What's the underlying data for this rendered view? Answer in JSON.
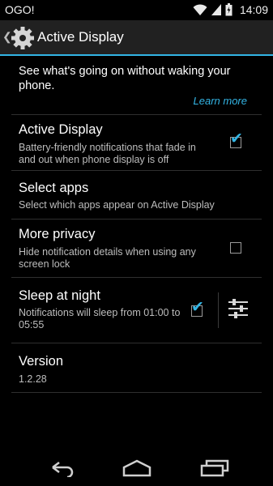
{
  "statusbar": {
    "carrier": "OGO!",
    "time": "14:09"
  },
  "actionbar": {
    "title": "Active Display"
  },
  "intro": {
    "text": "See what's going on without waking your phone.",
    "link": "Learn more"
  },
  "items": [
    {
      "title": "Active Display",
      "summary": "Battery-friendly notifications that fade in and out when phone display is off",
      "checked": true
    },
    {
      "title": "Select apps",
      "summary": "Select which apps appear on Active Display"
    },
    {
      "title": "More privacy",
      "summary": "Hide notification details when using any screen lock",
      "checked": false
    },
    {
      "title": "Sleep at night",
      "summary": "Notifications will sleep from 01:00 to 05:55",
      "checked": true
    },
    {
      "title": "Version",
      "summary": "1.2.28"
    }
  ],
  "colors": {
    "accent": "#33b5e5",
    "actionbar": "#212121",
    "background": "#000000"
  },
  "icons": [
    "wifi-icon",
    "signal-icon",
    "battery-icon",
    "settings-gear-icon",
    "checkbox-icon",
    "sliders-icon",
    "back-icon",
    "home-icon",
    "recents-icon"
  ]
}
